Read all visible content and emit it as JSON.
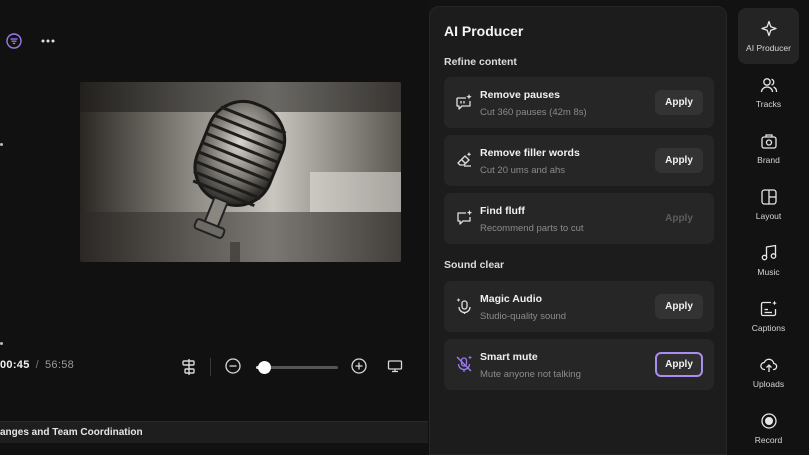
{
  "editor": {
    "time_current": "00:45",
    "time_separator": "/",
    "time_duration": "56:58",
    "zoom_level": 0.1,
    "chapter_title": "anges and Team Coordination"
  },
  "panel": {
    "title": "AI Producer",
    "sections": [
      {
        "label": "Refine content"
      },
      {
        "label": "Sound clear"
      }
    ],
    "cards": [
      {
        "title": "Remove pauses",
        "subtitle": "Cut 360 pauses (42m 8s)",
        "button": "Apply",
        "icon": "pause-sparkle-icon"
      },
      {
        "title": "Remove filler words",
        "subtitle": "Cut 20 ums and ahs",
        "button": "Apply",
        "icon": "eraser-icon"
      },
      {
        "title": "Find fluff",
        "subtitle": "Recommend parts to cut",
        "button": "Apply",
        "icon": "chat-sparkle-icon"
      },
      {
        "title": "Magic Audio",
        "subtitle": "Studio-quality sound",
        "button": "Apply",
        "icon": "magic-audio-icon"
      },
      {
        "title": "Smart mute",
        "subtitle": "Mute anyone not talking",
        "button": "Apply",
        "icon": "mic-off-icon"
      }
    ]
  },
  "sidebar": {
    "items": [
      {
        "label": "AI Producer",
        "icon": "sparkle-icon"
      },
      {
        "label": "Tracks",
        "icon": "people-icon"
      },
      {
        "label": "Brand",
        "icon": "brand-icon"
      },
      {
        "label": "Layout",
        "icon": "layout-icon"
      },
      {
        "label": "Music",
        "icon": "music-icon"
      },
      {
        "label": "Captions",
        "icon": "captions-icon"
      },
      {
        "label": "Uploads",
        "icon": "upload-icon"
      },
      {
        "label": "Record",
        "icon": "record-icon"
      }
    ]
  },
  "colors": {
    "accent": "#9a7cf0",
    "panel_bg": "#1c1c1c",
    "card_bg": "#262626",
    "app_bg": "#121212"
  }
}
